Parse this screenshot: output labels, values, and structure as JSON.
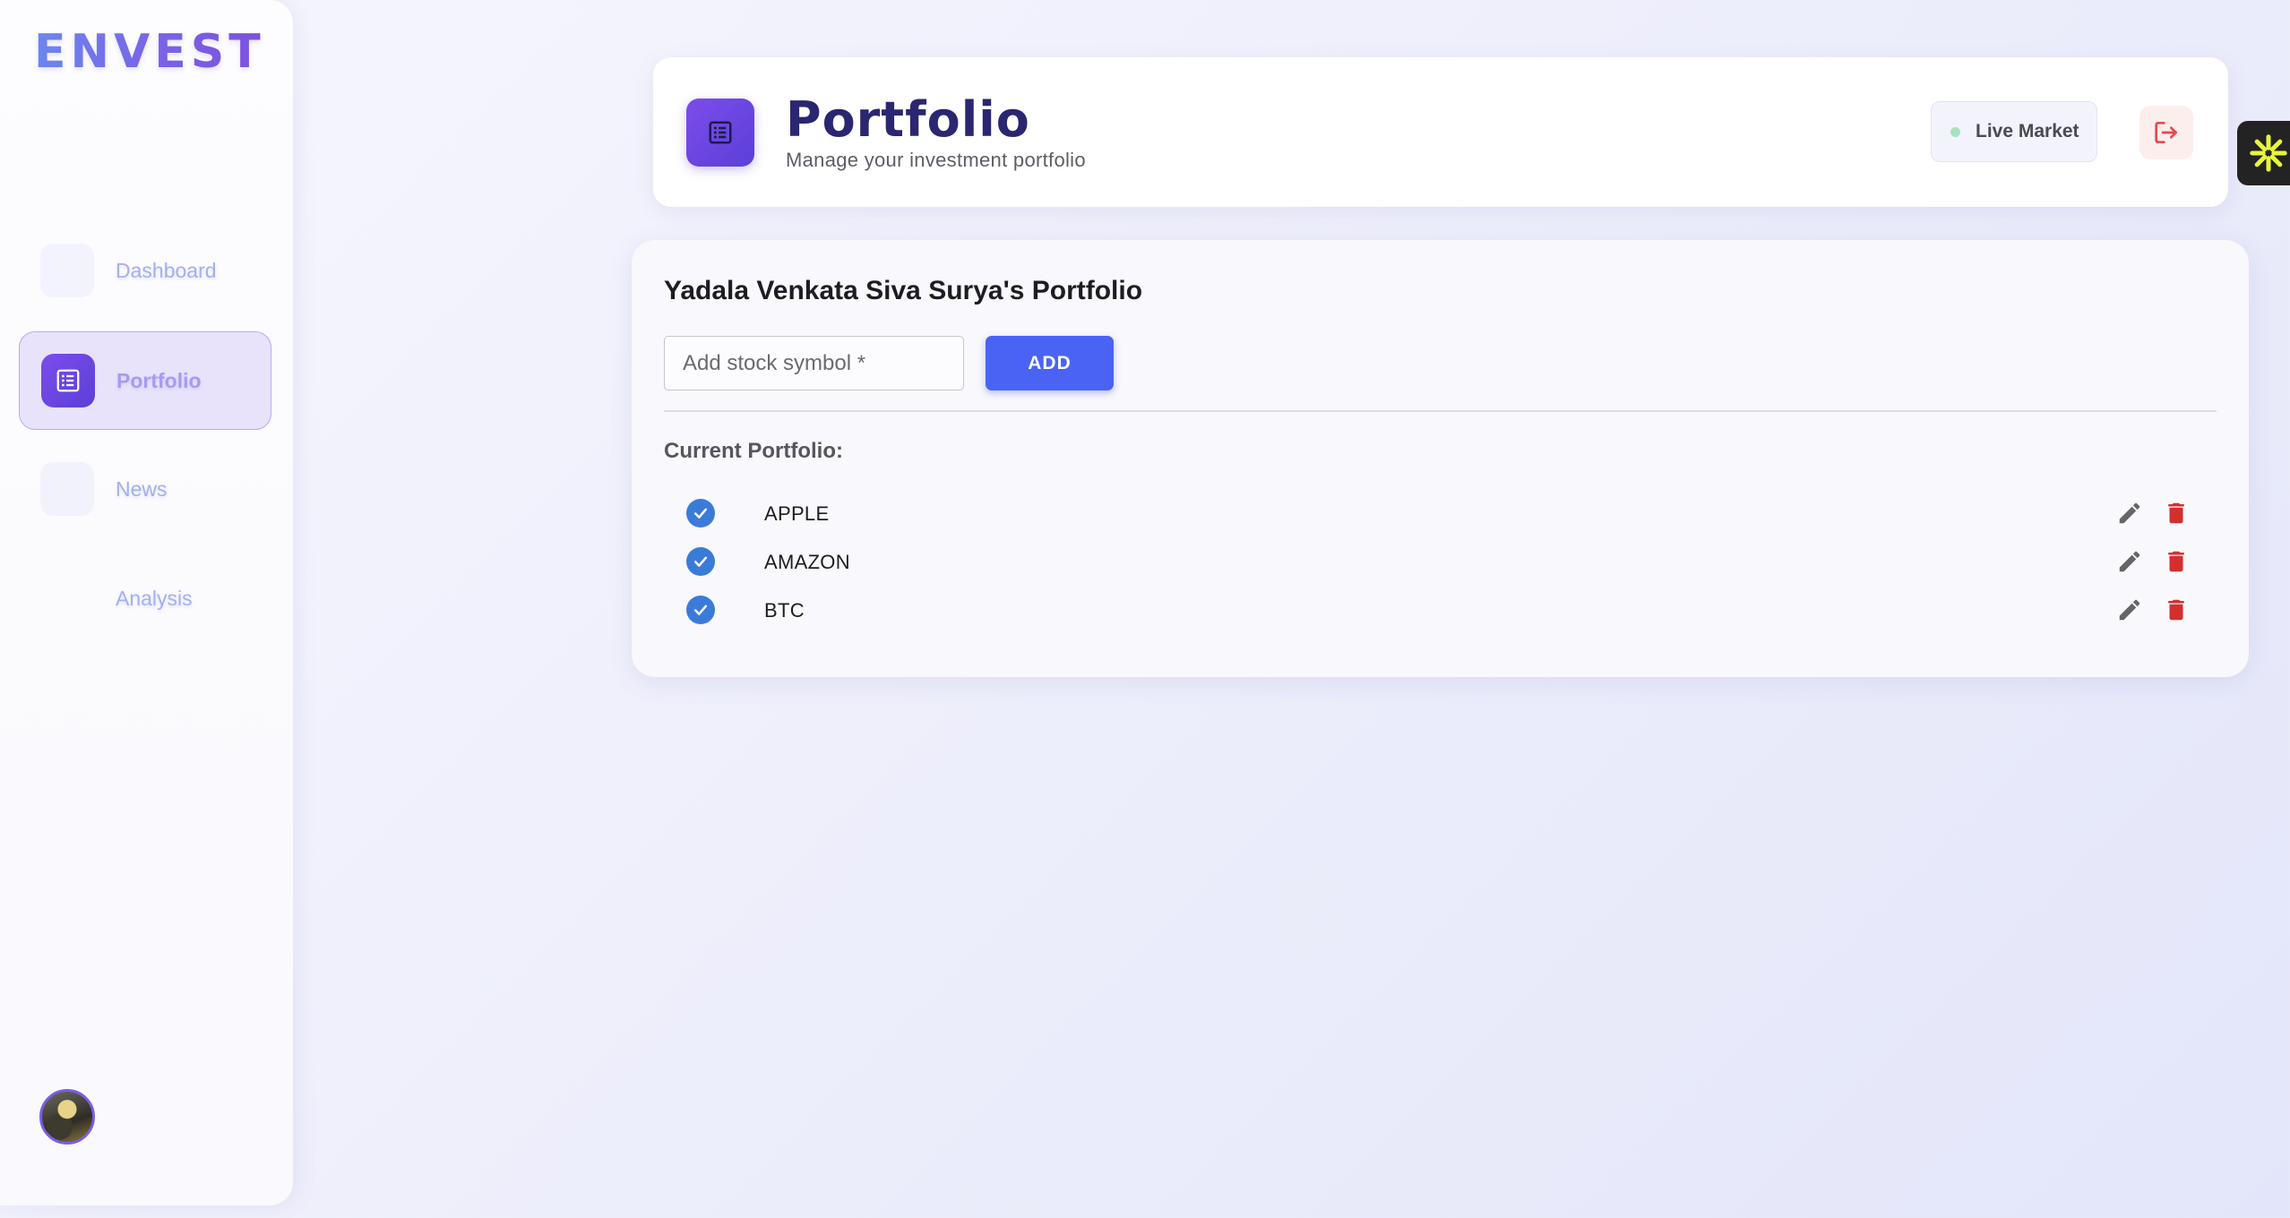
{
  "app": {
    "brand": "ENVEST"
  },
  "sidebar": {
    "items": [
      {
        "label": "Dashboard",
        "icon": "dashboard-icon",
        "active": false
      },
      {
        "label": "Portfolio",
        "icon": "list-icon",
        "active": true
      },
      {
        "label": "News",
        "icon": "news-icon",
        "active": false
      },
      {
        "label": "Analysis",
        "icon": "chart-icon",
        "active": false
      }
    ]
  },
  "header": {
    "title": "Portfolio",
    "subtitle": "Manage your investment portfolio",
    "market_status": "Live Market",
    "logout_icon": "logout-icon"
  },
  "portfolio": {
    "owner_title": "Yadala Venkata Siva Surya's Portfolio",
    "input_placeholder": "Add stock symbol *",
    "add_label": "ADD",
    "section_label": "Current Portfolio:",
    "holdings": [
      {
        "symbol": "APPLE",
        "checked": true
      },
      {
        "symbol": "AMAZON",
        "checked": true
      },
      {
        "symbol": "BTC",
        "checked": true
      }
    ]
  },
  "colors": {
    "accent": "#4a63f5",
    "brand_purple": "#6a45e4",
    "check_blue": "#3b7bd8",
    "delete_red": "#d32f2f",
    "edit_gray": "#666666",
    "live_dot": "#a9e2c0",
    "logout_red": "#e5484d"
  }
}
